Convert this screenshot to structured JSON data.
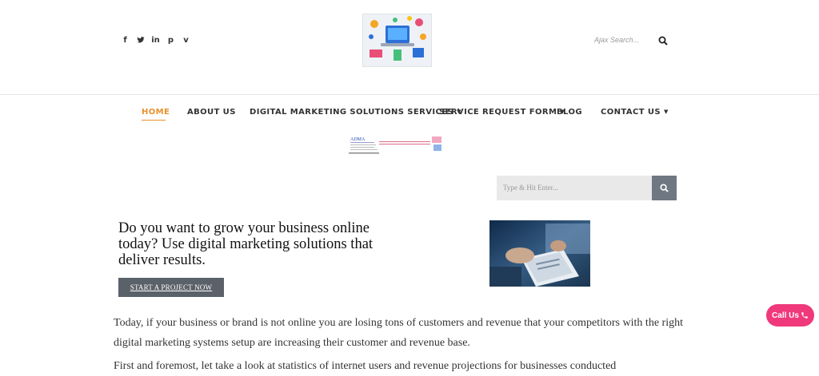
{
  "social": {
    "facebook": "f",
    "twitter": "t",
    "linkedin": "in",
    "pinterest": "p",
    "vimeo": "v"
  },
  "header": {
    "search_placeholder": "Ajax Search..."
  },
  "nav": {
    "items": [
      {
        "label": "HOME",
        "active": true
      },
      {
        "label": "ABOUT US"
      },
      {
        "label": "DIGITAL MARKETING SOLUTIONS SERVICES",
        "caret": true
      },
      {
        "label": "SERVICE REQUEST FORM",
        "caret": true
      },
      {
        "label": "BLOG"
      },
      {
        "label": "CONTACT US",
        "caret": true
      }
    ]
  },
  "banner": {
    "title": "ADMA"
  },
  "sidebar_search": {
    "placeholder": "Type & Hit Enter..."
  },
  "hero": {
    "title": "Do you want to grow your business online today? Use digital marketing solutions that deliver results.",
    "cta_label": "START A PROJECT NOW"
  },
  "content": {
    "paragraph1": "Today, if your business or brand is not online you are losing tons of customers and revenue that your competitors with the right digital marketing systems setup are increasing their customer and revenue base.",
    "paragraph2": "First and foremost, let take a look at statistics of internet users and revenue projections for businesses conducted"
  },
  "call_button": {
    "label": "Call Us"
  },
  "colors": {
    "accent": "#e8912d",
    "call": "#f0397a",
    "button": "#5b6169"
  }
}
